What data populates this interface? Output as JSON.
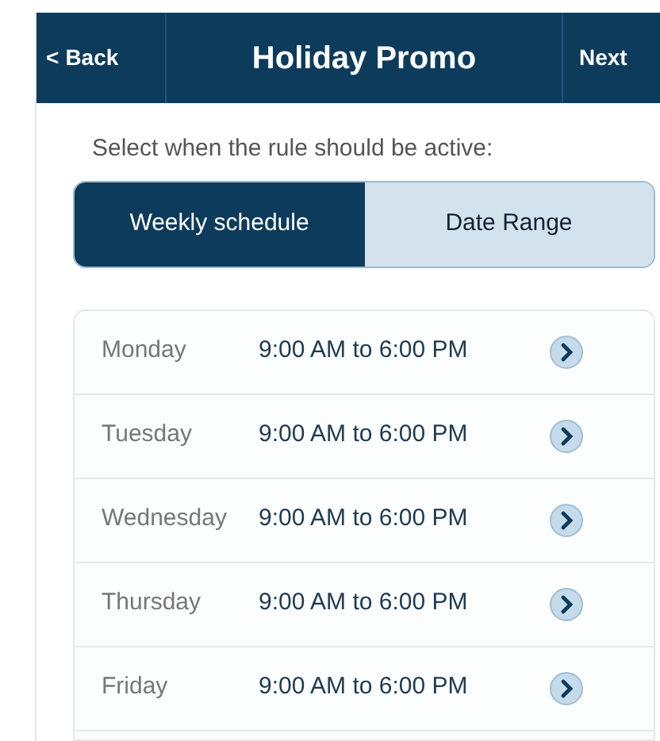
{
  "nav_bar": {
    "back": "Back",
    "back_icon": "<",
    "title": "Holiday Promo",
    "next": "Next"
  },
  "prompt": "Select when the rule should be active:",
  "segments": [
    {
      "label": "Weekly schedule",
      "selected": true
    },
    {
      "label": "Date Range",
      "selected": false
    }
  ],
  "schedule": [
    {
      "day": "Monday",
      "hours": "9:00 AM to 6:00 PM"
    },
    {
      "day": "Tuesday",
      "hours": "9:00 AM to 6:00 PM"
    },
    {
      "day": "Wednesday",
      "hours": "9:00 AM to 6:00 PM"
    },
    {
      "day": "Thursday",
      "hours": "9:00 AM to 6:00 PM"
    },
    {
      "day": "Friday",
      "hours": "9:00 AM to 6:00 PM"
    }
  ]
}
